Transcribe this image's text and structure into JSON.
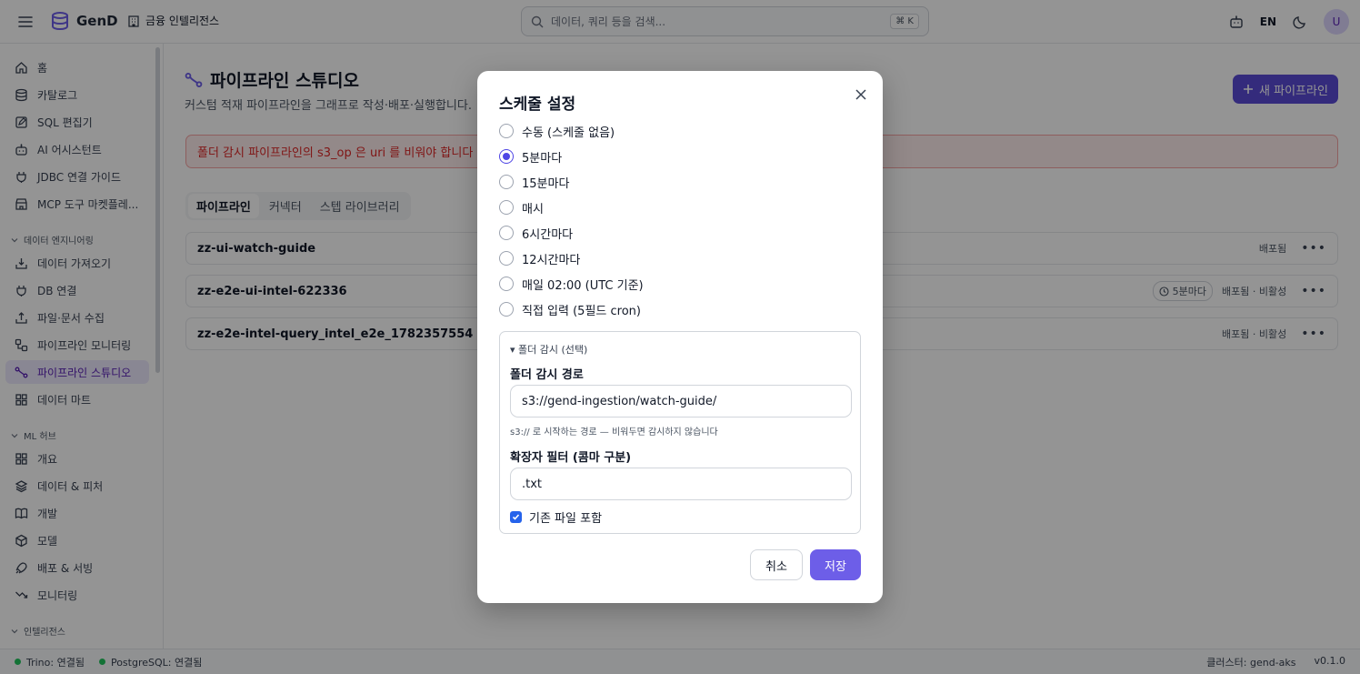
{
  "app": {
    "name": "GenD",
    "org": "금융 인텔리전스",
    "search_placeholder": "데이터, 쿼리 등을 검색...",
    "search_shortcut": "⌘ K",
    "lang": "EN",
    "avatar": "U"
  },
  "sidebar": {
    "top_items": [
      "홈",
      "카탈로그",
      "SQL 편집기",
      "AI 어시스턴트",
      "JDBC 연결 가이드",
      "MCP 도구 마켓플레..."
    ],
    "section_data_eng": "데이터 엔지니어링",
    "data_eng_items": [
      "데이터 가져오기",
      "DB 연결",
      "파일·문서 수집",
      "파이프라인 모니터링",
      "파이프라인 스튜디오",
      "데이터 마트"
    ],
    "section_ml": "ML 허브",
    "ml_items": [
      "개요",
      "데이터 & 피처",
      "개발",
      "모델",
      "배포 & 서빙",
      "모니터링"
    ],
    "section_intel": "인텔리전스"
  },
  "main": {
    "title": "파이프라인 스튜디오",
    "subtitle": "커스텀 적재 파이프라인을 그래프로 작성·배포·실행합니다.",
    "new_button": "새 파이프라인",
    "alert": "폴더 감시 파이프라인의 s3_op 은 uri 를 비워야 합니다",
    "tabs": [
      "파이프라인",
      "커넥터",
      "스텝 라이브러리"
    ],
    "rows": [
      {
        "name": "zz-ui-watch-guide",
        "schedule": "",
        "status": "배포됨"
      },
      {
        "name": "zz-e2e-ui-intel-622336",
        "schedule": "5분마다",
        "status": "배포됨 · 비활성"
      },
      {
        "name": "zz-e2e-intel-query_intel_e2e_1782357554",
        "schedule": "",
        "status": "배포됨 · 비활성"
      }
    ]
  },
  "status_bar": {
    "trino": "Trino: 연결됨",
    "postgres": "PostgreSQL: 연결됨",
    "cluster": "클러스터: gend-aks",
    "version": "v0.1.0"
  },
  "modal": {
    "title": "스케줄 설정",
    "options": [
      "수동 (스케줄 없음)",
      "5분마다",
      "15분마다",
      "매시",
      "6시간마다",
      "12시간마다",
      "매일 02:00 (UTC 기준)",
      "직접 입력 (5필드 cron)"
    ],
    "selected_index": 1,
    "folder_summary": "▾ 폴더 감시 (선택)",
    "path_label": "폴더 감시 경로",
    "path_value": "s3://gend-ingestion/watch-guide/",
    "path_help": "s3:// 로 시작하는 경로 — 비워두면 감시하지 않습니다",
    "ext_label": "확장자 필터 (콤마 구분)",
    "ext_value": ".txt",
    "include_existing_label": "기존 파일 포함",
    "include_existing": true,
    "cancel": "취소",
    "save": "저장"
  },
  "colors": {
    "accent": "#5b4bd6",
    "save_button": "#6d5ee8",
    "alert_text": "#dc2626",
    "connected": "#22c55e"
  }
}
